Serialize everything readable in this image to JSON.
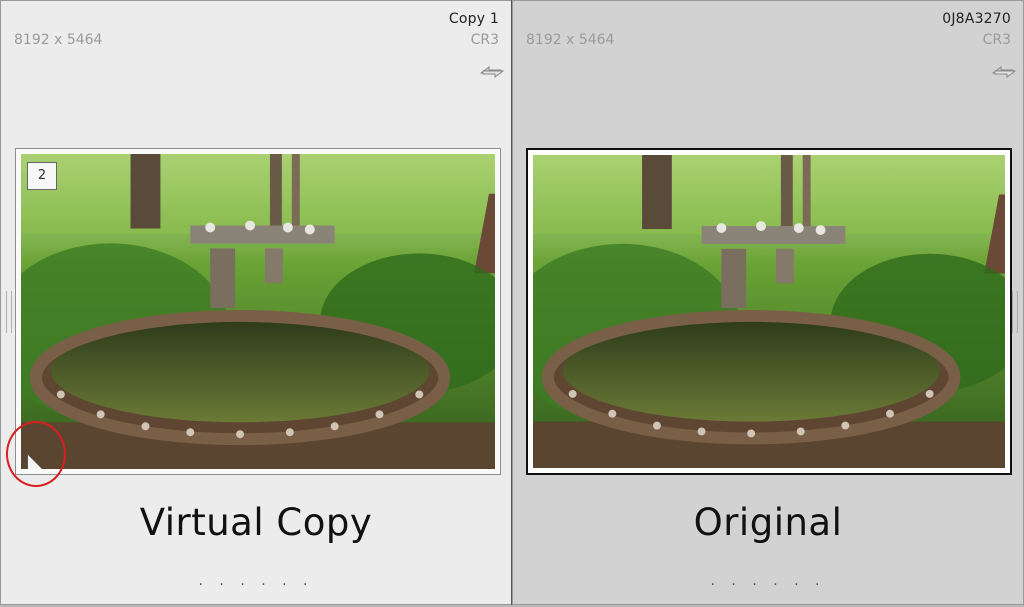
{
  "cells": [
    {
      "filename": "Copy 1",
      "dimensions": "8192 x 5464",
      "extension": "CR3",
      "badge": "2",
      "caption": "Virtual Copy",
      "dots": ". . . . . ."
    },
    {
      "filename": "0J8A3270",
      "dimensions": "8192 x 5464",
      "extension": "CR3",
      "caption": "Original",
      "dots": ". . . . . ."
    }
  ],
  "colors": {
    "highlight_circle": "#d81e1e",
    "selected_frame": "#111111",
    "left_cell_bg": "#ececec",
    "right_cell_bg": "#d2d2d2"
  },
  "icons": [
    "swap-arrow-icon",
    "virtual-copy-corner-icon",
    "resize-handle-icon"
  ]
}
